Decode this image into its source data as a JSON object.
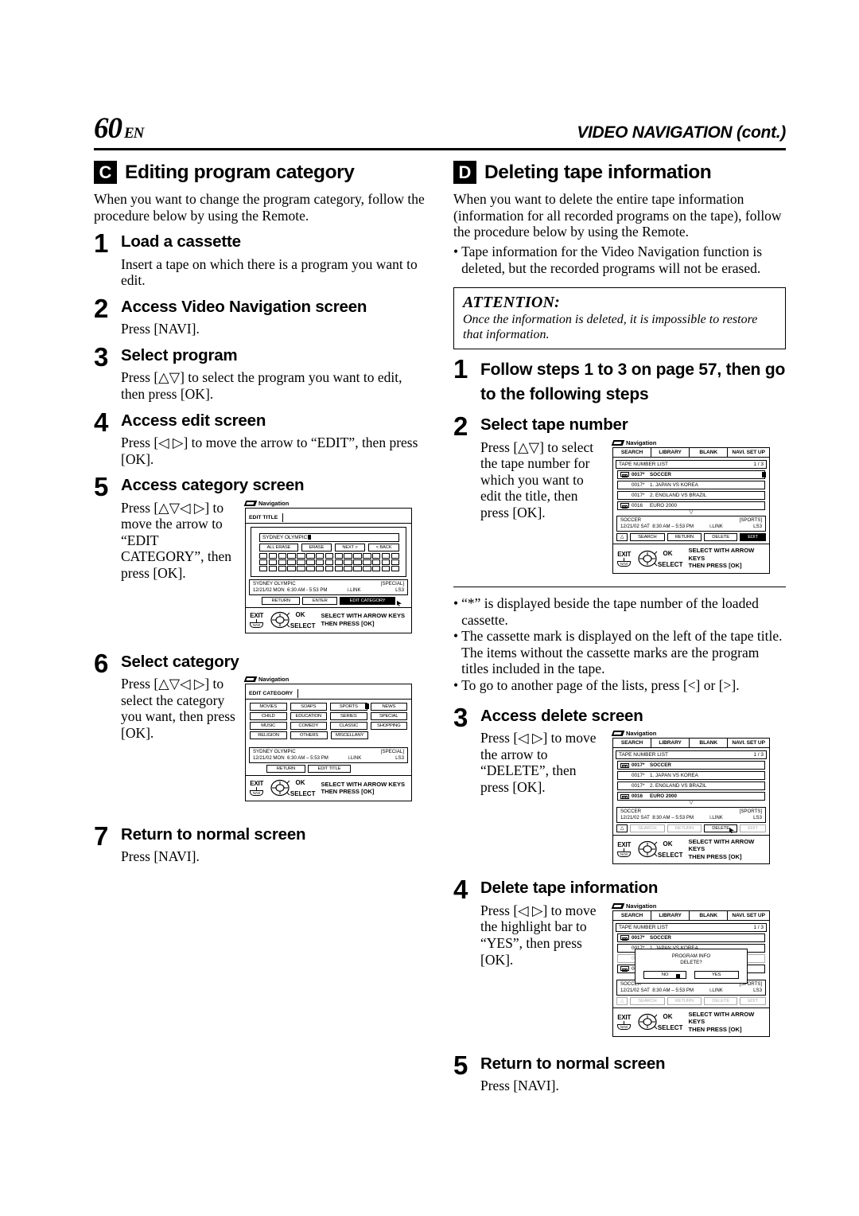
{
  "header": {
    "page_number": "60",
    "page_lang": "EN",
    "running_head": "VIDEO NAVIGATION (cont.)"
  },
  "left_column": {
    "badge": "C",
    "title": "Editing program category",
    "intro": "When you want to change the program category, follow the procedure below by using the Remote.",
    "steps": [
      {
        "num": "1",
        "title": "Load a cassette",
        "text": "Insert a tape on which there is a program you want to edit."
      },
      {
        "num": "2",
        "title": "Access Video Navigation screen",
        "text": "Press [NAVI]."
      },
      {
        "num": "3",
        "title": "Select program",
        "text": "Press [△▽] to select the program you want to edit, then press [OK]."
      },
      {
        "num": "4",
        "title": "Access edit screen",
        "text": "Press [◁ ▷] to move the arrow to “EDIT”, then press [OK]."
      },
      {
        "num": "5",
        "title": "Access category screen",
        "text": "Press [△▽◁ ▷] to move the arrow to “EDIT CATEGORY”, then press [OK]."
      },
      {
        "num": "6",
        "title": "Select category",
        "text": "Press [△▽◁ ▷] to select the category you want, then press [OK]."
      },
      {
        "num": "7",
        "title": "Return to normal screen",
        "text": "Press [NAVI]."
      }
    ]
  },
  "right_column": {
    "badge": "D",
    "title": "Deleting tape information",
    "intro": "When you want to delete the entire tape information (information for all recorded programs on the tape), follow the procedure below by using the Remote.",
    "intro_bullet": "Tape information for the Video Navigation function is deleted, but the recorded programs will not be erased.",
    "attention": {
      "heading": "ATTENTION:",
      "body": "Once the information is deleted, it is impossible to restore that information."
    },
    "steps": [
      {
        "num": "1",
        "title": "Follow steps 1 to 3 on page 57, then go to the following steps",
        "text": ""
      },
      {
        "num": "2",
        "title": "Select tape number",
        "text": "Press [△▽] to select the tape number for which you want to edit the title, then press [OK]."
      },
      {
        "num": "3",
        "title": "Access delete screen",
        "text": "Press [◁ ▷] to move the arrow to “DELETE”, then press [OK]."
      },
      {
        "num": "4",
        "title": "Delete tape information",
        "text": "Press [◁ ▷] to move the highlight bar to “YES”, then press [OK]."
      },
      {
        "num": "5",
        "title": "Return to normal screen",
        "text": "Press [NAVI]."
      }
    ],
    "bullets": [
      "“*” is displayed beside the tape number of the loaded cassette.",
      "The cassette mark is displayed on the left of the tape title. The items without the cassette marks are the program titles included in the tape.",
      "To go to another page of the lists, press [<] or [>]."
    ]
  },
  "osd_common": {
    "nav_label": "Navigation",
    "exit_label": "EXIT",
    "exit_key": "NAVI",
    "ok_label": "OK",
    "select_label": "SELECT",
    "help_line1": "SELECT WITH ARROW KEYS",
    "help_line2": "THEN PRESS [OK]"
  },
  "edit_title_screen": {
    "tab": "EDIT TITLE",
    "title_value": "SYDNEY OLYMPIC",
    "kb_buttons": [
      "ALL ERASE",
      "ERASE",
      "NEXT >",
      "< BACK"
    ],
    "info": {
      "title": "SYDNEY OLYMPIC",
      "date": "12/21/02 MON",
      "time": "6:30 AM - 5:53 PM",
      "link": "i.LINK",
      "category": "[SPECIAL]",
      "speed": "LS3"
    },
    "buttons": [
      "RETURN",
      "ENTER",
      "EDIT CATEGORY"
    ],
    "selected_button": "EDIT CATEGORY"
  },
  "edit_category_screen": {
    "tab": "EDIT CATEGORY",
    "categories": [
      [
        "MOVIES",
        "SOAPS",
        "SPORTS",
        "NEWS"
      ],
      [
        "CHILD",
        "EDUCATION",
        "SERIES",
        "SPECIAL"
      ],
      [
        "MUSIC",
        "COMEDY",
        "CLASSIC",
        "SHOPPING"
      ],
      [
        "RELIGION",
        "OTHERS",
        "MISCELLANY",
        ""
      ]
    ],
    "info": {
      "title": "SYDNEY OLYMPIC",
      "date": "12/21/02 MON",
      "time": "6:30 AM – 5:53 PM",
      "link": "i.LINK",
      "category": "[SPECIAL]",
      "speed": "LS3"
    },
    "buttons": [
      "RETURN",
      "EDIT TITLE"
    ]
  },
  "library_screen": {
    "tabs": [
      "SEARCH",
      "LIBRARY",
      "BLANK",
      "NAVI. SET UP"
    ],
    "active_tab": "LIBRARY",
    "list_title": "TAPE NUMBER LIST",
    "page_indicator": "1 / 3",
    "rows": [
      {
        "mark": true,
        "num": "0017*",
        "label": "SOCCER",
        "bold": true,
        "indent": false
      },
      {
        "mark": false,
        "num": "0017*",
        "label": "1. JAPAN VS KOREA",
        "bold": false,
        "indent": true
      },
      {
        "mark": false,
        "num": "0017*",
        "label": "2. ENGLAND VS BRAZIL",
        "bold": false,
        "indent": true
      },
      {
        "mark": true,
        "num": "0016",
        "label": "EURO 2000",
        "bold": false,
        "indent": false
      }
    ],
    "info": {
      "title": "SOCCER",
      "date": "12/21/02 SAT",
      "time": "8:30 AM – 5:53 PM",
      "link": "i.LINK",
      "category": "[SPORTS]",
      "speed": "LS3"
    },
    "buttons": [
      "SEARCH",
      "RETURN",
      "DELETE",
      "EDIT"
    ],
    "selected_button_step3": "DELETE"
  },
  "delete_dialog": {
    "line1": "PROGRAM INFO",
    "line2": "DELETE?",
    "no_label": "NO",
    "yes_label": "YES",
    "highlighted": "NO"
  }
}
